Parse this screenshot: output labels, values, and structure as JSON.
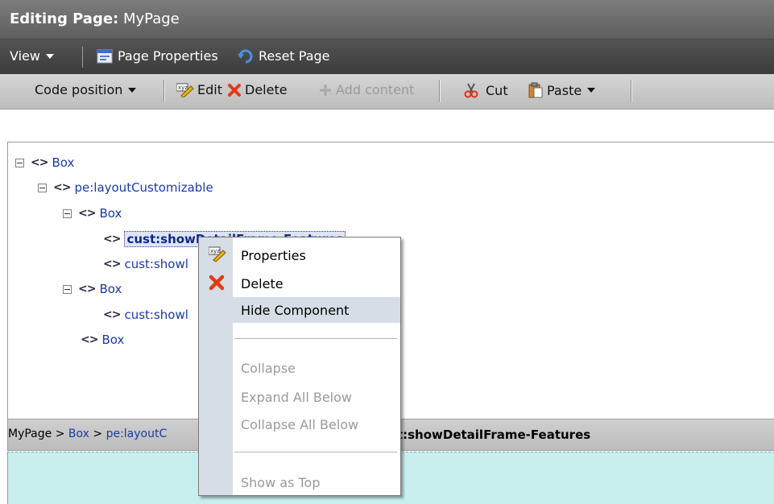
{
  "title": {
    "prefix": "Editing Page:",
    "page": "MyPage"
  },
  "toolbar1": {
    "view_label": "View",
    "page_properties_label": "Page Properties",
    "reset_page_label": "Reset Page"
  },
  "toolbar2": {
    "code_position_label": "Code position",
    "edit_label": "Edit",
    "delete_label": "Delete",
    "add_content_label": "Add content",
    "cut_label": "Cut",
    "paste_label": "Paste"
  },
  "tree": {
    "nodes": [
      {
        "label": "Box"
      },
      {
        "label": "pe:layoutCustomizable"
      },
      {
        "label": "Box"
      },
      {
        "label": "cust:showDetailFrame-Features"
      },
      {
        "label": "cust:showl"
      },
      {
        "label": "Box"
      },
      {
        "label": "cust:showl"
      },
      {
        "label": "Box"
      }
    ]
  },
  "breadcrumb": {
    "items": [
      "MyPage",
      "Box",
      "pe:layoutC"
    ],
    "separator": ">",
    "tail": "st:showDetailFrame-Features"
  },
  "context_menu": {
    "items": [
      {
        "label": "Properties",
        "icon": "edit-icon",
        "enabled": true
      },
      {
        "label": "Delete",
        "icon": "delete-icon",
        "enabled": true
      },
      {
        "label": "Hide Component",
        "icon": "",
        "enabled": true,
        "hovered": true
      },
      {
        "label": "Collapse",
        "enabled": false
      },
      {
        "label": "Expand All Below",
        "enabled": false
      },
      {
        "label": "Collapse All Below",
        "enabled": false
      },
      {
        "label": "Show as Top",
        "enabled": false
      }
    ]
  },
  "colors": {
    "title_bar": "#6b6b6b",
    "link_blue": "#1a3aa8",
    "preview_bg": "#c8eeee",
    "menu_gutter": "#d7dde4"
  }
}
